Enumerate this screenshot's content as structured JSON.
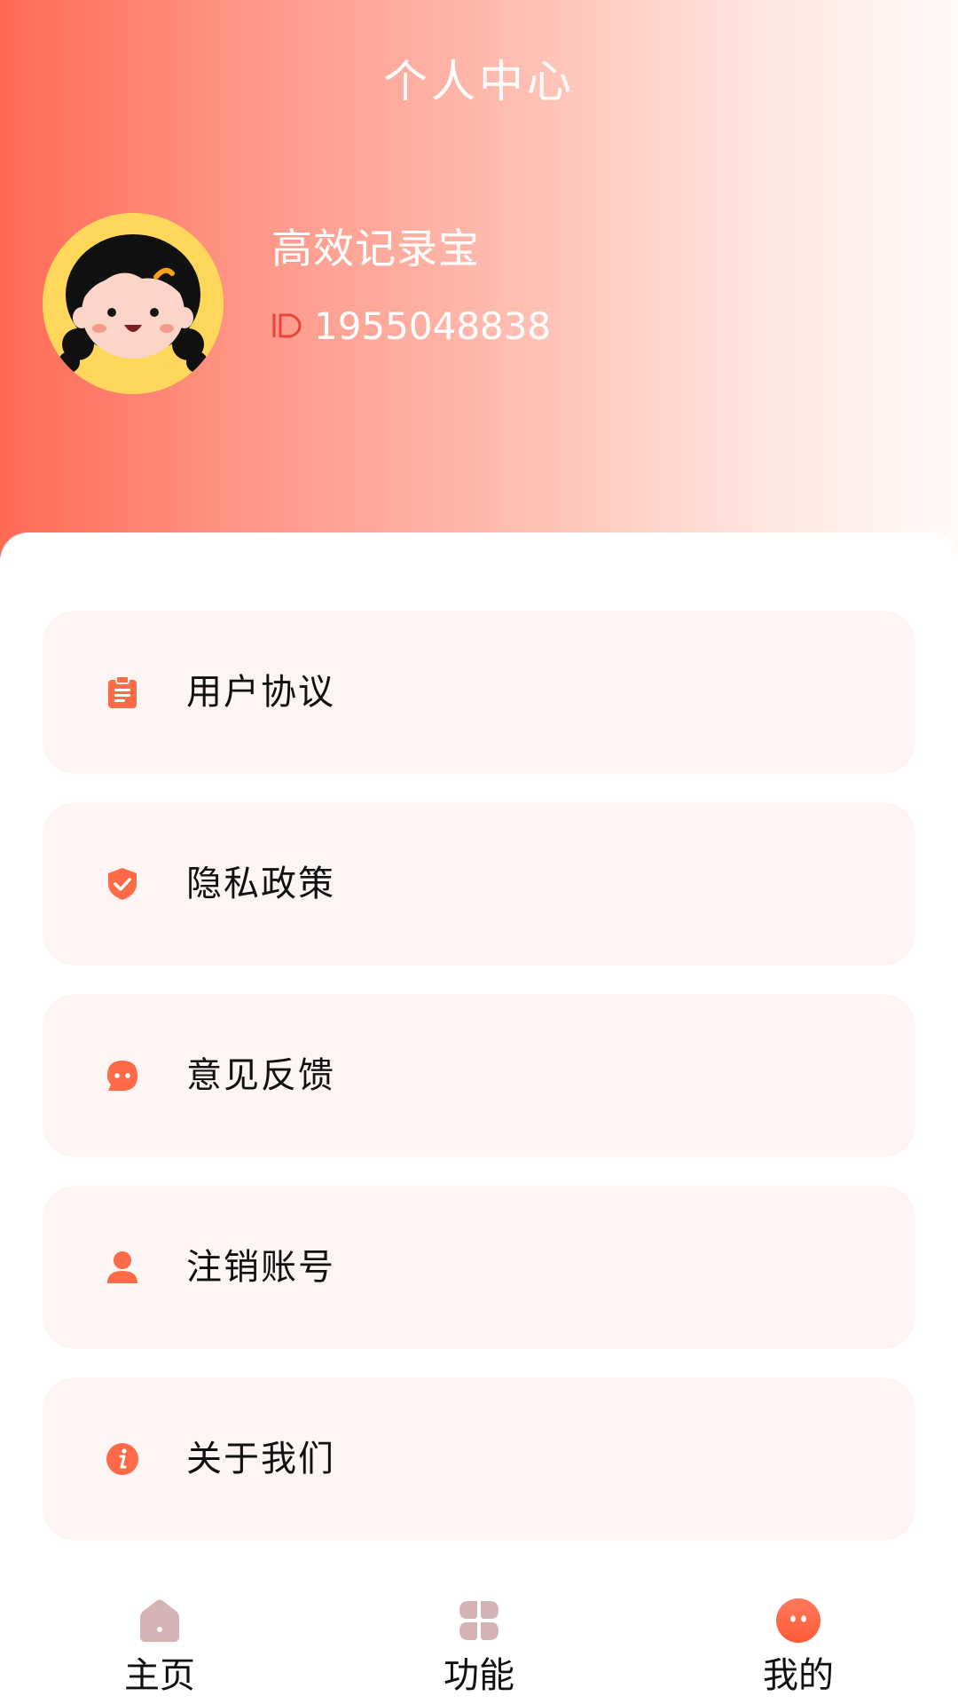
{
  "header": {
    "title": "个人中心",
    "gradient_start": "#ff6a55",
    "gradient_end": "#fffaf8"
  },
  "profile": {
    "name": "高效记录宝",
    "id_label": "1955048838",
    "avatar_icon": "cartoon-girl-avatar",
    "avatar_bg": "#ffd75a"
  },
  "menu": {
    "items": [
      {
        "label": "用户协议",
        "icon": "clipboard-icon"
      },
      {
        "label": "隐私政策",
        "icon": "shield-check-icon"
      },
      {
        "label": "意见反馈",
        "icon": "chat-bubble-icon"
      },
      {
        "label": "注销账号",
        "icon": "user-icon"
      },
      {
        "label": "关于我们",
        "icon": "info-icon"
      }
    ],
    "accent": "#ff6a47",
    "item_bg": "#fdf5f4"
  },
  "tabbar": {
    "tabs": [
      {
        "label": "主页",
        "icon": "home-icon",
        "active": false
      },
      {
        "label": "功能",
        "icon": "grid-icon",
        "active": false
      },
      {
        "label": "我的",
        "icon": "profile-face-icon",
        "active": true
      }
    ],
    "inactive_color": "#d4b4b4",
    "active_color": "#ff6a47"
  }
}
